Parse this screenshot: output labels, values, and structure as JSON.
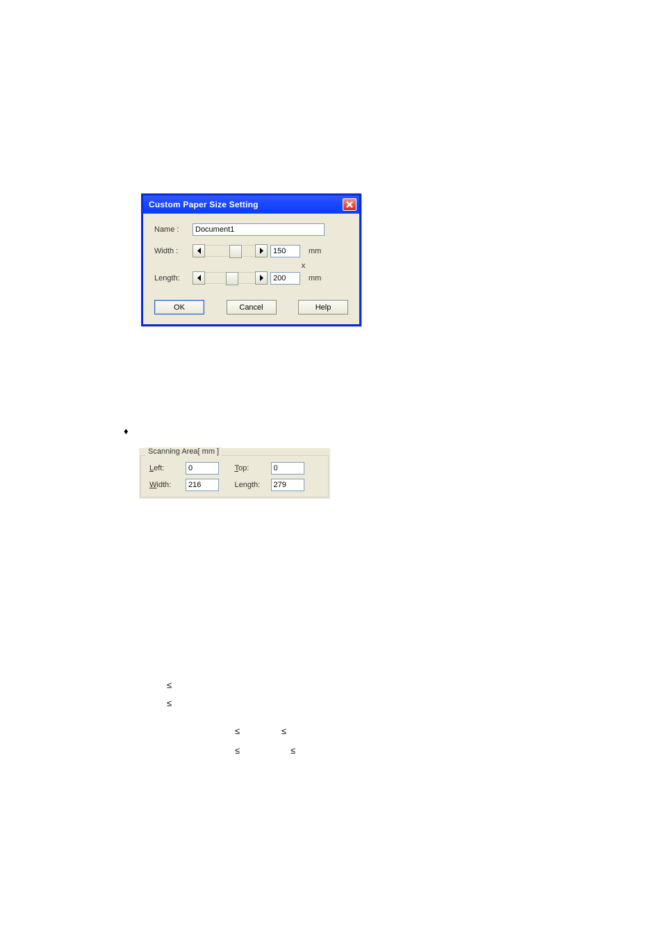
{
  "dialog": {
    "title": "Custom Paper Size Setting",
    "name_label": "Name :",
    "name_value": "Document1",
    "width_label": "Width :",
    "width_value": "150",
    "length_label": "Length:",
    "length_value": "200",
    "unit": "mm",
    "times": "x",
    "ok": "OK",
    "cancel": "Cancel",
    "help": "Help"
  },
  "scanarea": {
    "legend": "Scanning Area[ mm ]",
    "left_label_u": "L",
    "left_label_rest": "eft:",
    "left_value": "0",
    "top_label_u": "T",
    "top_label_rest": "op:",
    "top_value": "0",
    "width_label_u": "W",
    "width_label_rest": "idth:",
    "width_value": "216",
    "length_label_u": "L",
    "length_label_rest": "ength:",
    "length_value": "279"
  },
  "glyphs": {
    "bullet": "♦",
    "le": "≤"
  }
}
